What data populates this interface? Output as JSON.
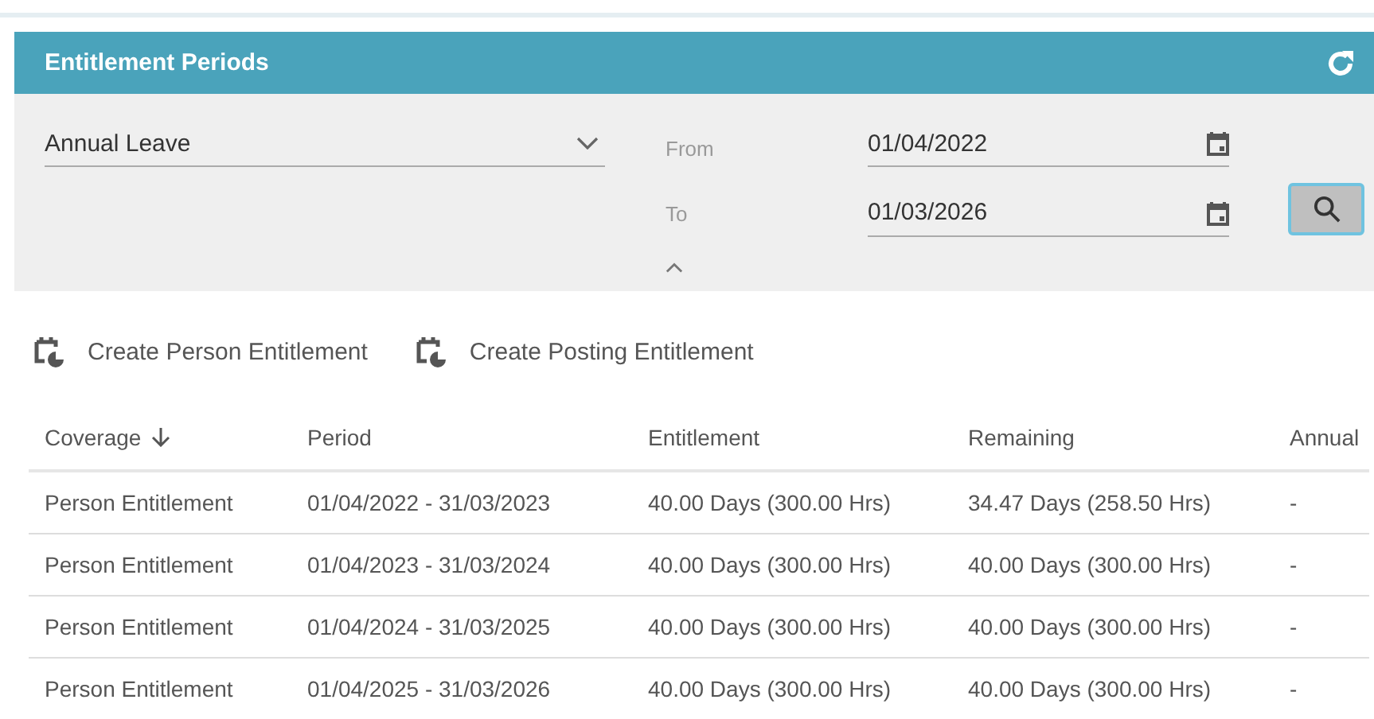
{
  "panel": {
    "title": "Entitlement Periods"
  },
  "filter": {
    "leave_type": "Annual Leave",
    "from_label": "From",
    "from_value": "01/04/2022",
    "to_label": "To",
    "to_value": "01/03/2026",
    "expanded": true
  },
  "actions": [
    {
      "label": "Create Person Entitlement"
    },
    {
      "label": "Create Posting Entitlement"
    }
  ],
  "table": {
    "columns": [
      {
        "label": "Coverage",
        "sorted": true
      },
      {
        "label": "Period",
        "sorted": false
      },
      {
        "label": "Entitlement",
        "sorted": false
      },
      {
        "label": "Remaining",
        "sorted": false
      },
      {
        "label": "Annual",
        "sorted": false
      }
    ],
    "rows": [
      [
        "Person Entitlement",
        "01/04/2022 - 31/03/2023",
        "40.00 Days (300.00 Hrs)",
        "34.47 Days (258.50 Hrs)",
        "-"
      ],
      [
        "Person Entitlement",
        "01/04/2023 - 31/03/2024",
        "40.00 Days (300.00 Hrs)",
        "40.00 Days (300.00 Hrs)",
        "-"
      ],
      [
        "Person Entitlement",
        "01/04/2024 - 31/03/2025",
        "40.00 Days (300.00 Hrs)",
        "40.00 Days (300.00 Hrs)",
        "-"
      ],
      [
        "Person Entitlement",
        "01/04/2025 - 31/03/2026",
        "40.00 Days (300.00 Hrs)",
        "40.00 Days (300.00 Hrs)",
        "-"
      ]
    ]
  }
}
